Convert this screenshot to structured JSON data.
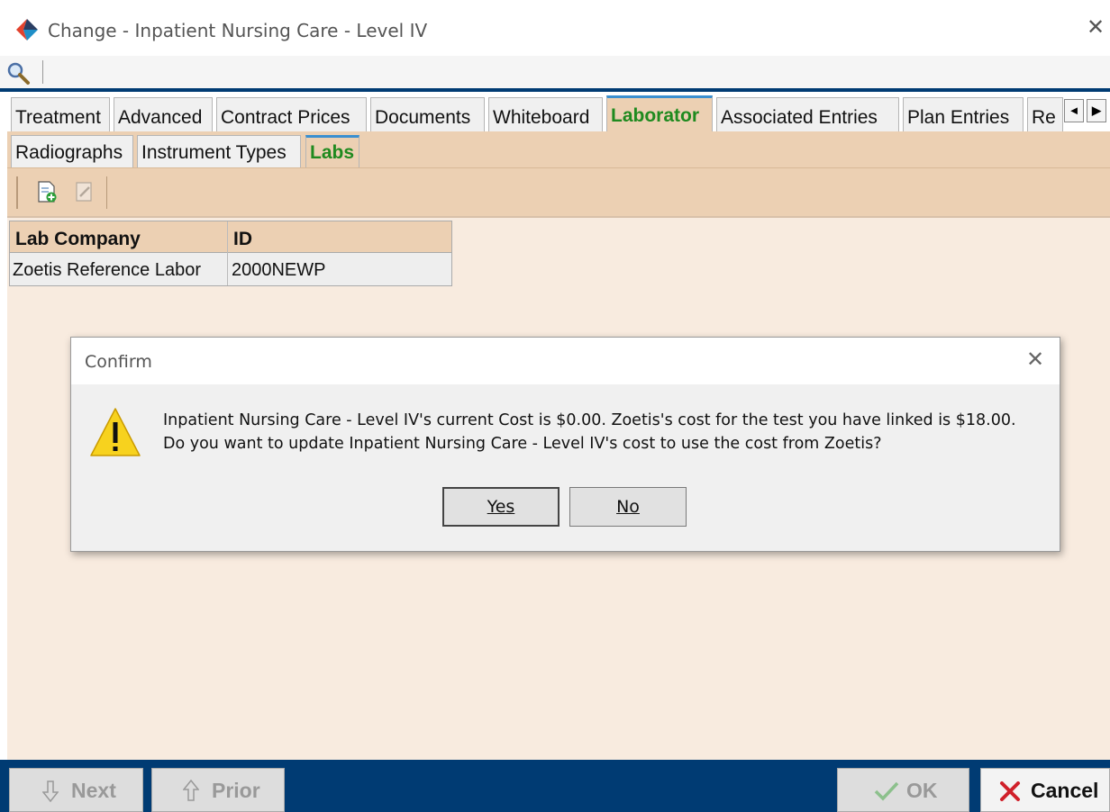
{
  "window": {
    "title": "Change - Inpatient Nursing Care - Level IV",
    "close_glyph": "✕"
  },
  "tabs_main": [
    {
      "label": "Treatment",
      "active": false
    },
    {
      "label": "Advanced",
      "active": false
    },
    {
      "label": "Contract Prices",
      "active": false
    },
    {
      "label": "Documents",
      "active": false
    },
    {
      "label": "Whiteboard",
      "active": false
    },
    {
      "label": "Laborator",
      "active": true
    },
    {
      "label": "Associated Entries",
      "active": false
    },
    {
      "label": "Plan Entries",
      "active": false
    },
    {
      "label": "Re",
      "active": false
    }
  ],
  "tabs_sub": [
    {
      "label": "Radiographs",
      "active": false
    },
    {
      "label": "Instrument Types",
      "active": false
    },
    {
      "label": "Labs",
      "active": true
    }
  ],
  "tab_scroll": {
    "left": "◄",
    "right": "▶"
  },
  "table": {
    "columns": [
      "Lab Company",
      "ID"
    ],
    "rows": [
      [
        "Zoetis Reference Labor",
        "2000NEWP"
      ]
    ]
  },
  "dialog": {
    "title": "Confirm",
    "close_glyph": "✕",
    "message_line1": "Inpatient Nursing Care - Level IV's current Cost is $0.00.  Zoetis's cost for the test you have linked is $18.00.",
    "message_line2": "Do you want to update Inpatient Nursing Care - Level IV's cost to use the cost from Zoetis?",
    "yes_label": "Yes",
    "no_label": "No"
  },
  "bottom": {
    "next_label": "Next",
    "prior_label": "Prior",
    "ok_label": "OK",
    "cancel_label": "Cancel"
  },
  "colors": {
    "accent_blue": "#003b73",
    "tab_active_text": "#1f8a1f",
    "panel_tan": "#ecd0b3",
    "cancel_red": "#d0202a"
  }
}
